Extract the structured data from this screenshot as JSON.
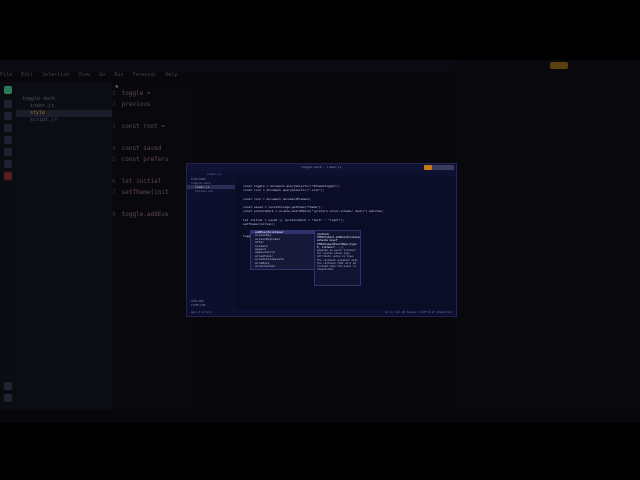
{
  "background_ide": {
    "menu": [
      "File",
      "Edit",
      "Selection",
      "View",
      "Go",
      "Run",
      "Terminal",
      "Help"
    ],
    "explorer_items": [
      "toggle-dark",
      "index.js",
      "styles.css",
      "style",
      "script.js"
    ],
    "editor_lines": [
      {
        "num": "1",
        "text": "toggle ="
      },
      {
        "num": "2",
        "text": "previous"
      },
      {
        "num": "",
        "text": ""
      },
      {
        "num": "3",
        "text": "const root ="
      },
      {
        "num": "",
        "text": ""
      },
      {
        "num": "4",
        "text": "const saved"
      },
      {
        "num": "5",
        "text": "const prefers"
      },
      {
        "num": "",
        "text": ""
      },
      {
        "num": "6",
        "text": "let initial"
      },
      {
        "num": "7",
        "text": "setTheme(init"
      },
      {
        "num": "",
        "text": ""
      },
      {
        "num": "9",
        "text": "toggle.addEve"
      }
    ],
    "accent_button_color": "#5a4010"
  },
  "foreground_ide": {
    "title": "toggle-dark — index.js",
    "tab_label": "index.js",
    "sidebar_items": [
      "EXPLORER",
      "toggle-dark",
      "index.js",
      "styles.css",
      "index.html"
    ],
    "sidebar_footer": [
      "OUTLINE",
      "TIMELINE"
    ],
    "code_lines": [
      "const toggle = document.querySelector(\"#themeToggle\");",
      "const icon = document.querySelector(\".icon\");",
      "",
      "const root = document.documentElement;",
      "",
      "const saved = localStorage.getItem(\"theme\");",
      "const prefersDark = window.matchMedia(\"(prefers-color-scheme: dark)\").matches;",
      "",
      "let initial = saved || (prefersDark ? \"dark\" : \"light\");",
      "setTheme(initial);",
      "",
      "",
      "toggle.addEventListener(\"click\", () => {"
    ],
    "autocomplete_items": [
      "addEventListener",
      "accessKey",
      "accessKeyLabel",
      "after",
      "animate",
      "append",
      "appendChild",
      "ariaAtomic",
      "ariaAutoComplete",
      "ariaBusy",
      "ariaChecked",
      "ariaColCount"
    ],
    "doc_signature": "(method) HTMLElement.addEventListener<K extends keyof HTMLElementEventMap>(type: K, listener: ...)",
    "doc_text": "Appends an event listener for events whose type attribute value is type. The callback argument sets the callback that will be invoked when the event is dispatched.",
    "status_left": "main  0 errors",
    "status_right": "Ln 13, Col 26  Spaces: 2  UTF-8  LF  JavaScript",
    "run_accent_color": "#c47a14"
  }
}
